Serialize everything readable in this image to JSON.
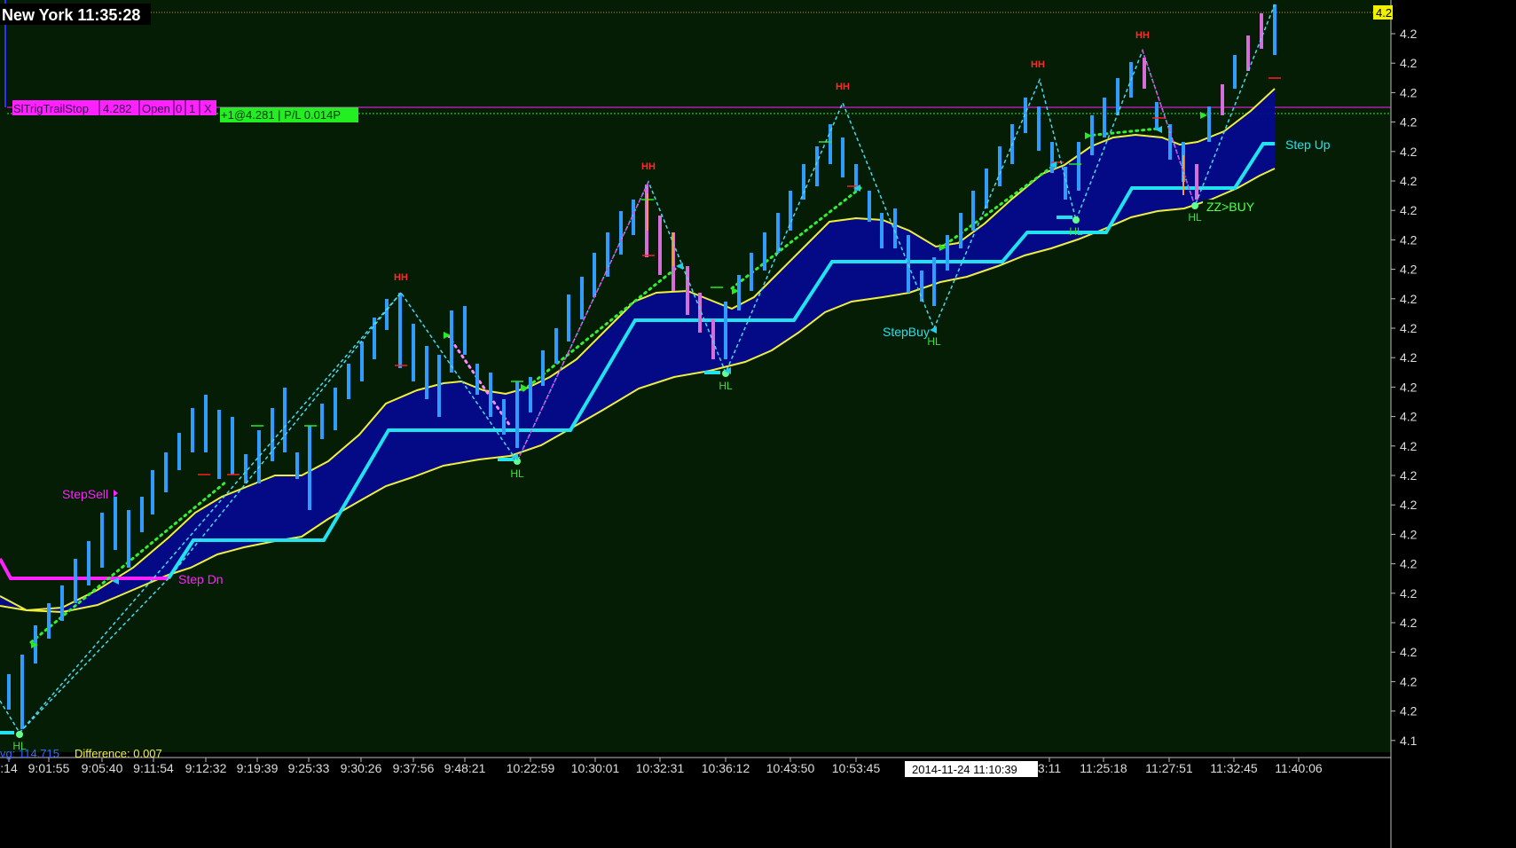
{
  "clock_label": "New York 11:35:28",
  "order_bar": {
    "strategy": "SlTrigTrailStop",
    "price": "4.282",
    "status": "Open",
    "qty_a": "0",
    "qty_b": "1",
    "close": "X"
  },
  "position_label": "+1@4.281 | P/L 0.014P",
  "bottom_status": {
    "avg": "vg: 114.715",
    "difference": "Difference: 0.007"
  },
  "crosshair_time": "2014-11-24  11:10:39",
  "price_axis": {
    "current_price_box": "4.2",
    "tick_labels": [
      "4.2",
      "4.2",
      "4.2",
      "4.2",
      "4.2",
      "4.2",
      "4.2",
      "4.2",
      "4.2",
      "4.2",
      "4.2",
      "4.2",
      "4.2",
      "4.2",
      "4.2",
      "4.2",
      "4.2",
      "4.2",
      "4.2",
      "4.2",
      "4.2",
      "4.2",
      "4.2",
      "4.2",
      "4.1"
    ]
  },
  "time_axis": {
    "tick_labels": [
      ":14",
      "9:01:55",
      "9:05:40",
      "9:11:54",
      "9:12:32",
      "9:19:39",
      "9:25:33",
      "9:30:26",
      "9:37:56",
      "9:48:21",
      "10:22:59",
      "10:30:01",
      "10:32:31",
      "10:36:12",
      "10:43:50",
      "10:53:45",
      "3:11",
      "11:25:18",
      "11:27:51",
      "11:32:45",
      "11:40:06"
    ]
  },
  "annotations": {
    "hh": "HH",
    "hl": "HL",
    "step_sell": "StepSell",
    "step_dn": "Step Dn",
    "step_buy": "StepBuy",
    "step_up": "Step Up",
    "zz_buy": "ZZ>BUY"
  },
  "colors": {
    "background": "#061d05",
    "bars_up": "#2f9cff",
    "bars_down": "#d76dd8",
    "zigzag": "#49d8f0",
    "band_fill": "#040a8c",
    "band_line": "#f0f03a",
    "step_line": "#21e3ef",
    "step_line_sell": "#ff22ff",
    "trend_dots": "#34ee34",
    "hh": "#ff2a2a",
    "hl": "#39e139",
    "order_bar_bg": "#ff22ff",
    "position_bg": "#22ee22"
  },
  "chart_data": {
    "type": "line",
    "title": "",
    "symbol_clock": "New York 11:35:28",
    "x": [
      "9:01:55",
      "9:05:40",
      "9:11:54",
      "9:12:32",
      "9:19:39",
      "9:25:33",
      "9:30:26",
      "9:37:56",
      "9:48:21",
      "10:22:59",
      "10:30:01",
      "10:32:31",
      "10:36:12",
      "10:43:50",
      "10:53:45",
      "11:10:39",
      "11:25:18",
      "11:27:51",
      "11:32:45",
      "11:40:06"
    ],
    "series": [
      {
        "name": "Step Dn",
        "values": [
          4.173,
          4.173,
          4.173,
          null,
          null,
          null,
          null,
          null,
          null,
          null,
          null,
          null,
          null,
          null,
          null,
          null,
          null,
          null,
          null,
          null
        ]
      },
      {
        "name": "Step Up",
        "values": [
          null,
          null,
          null,
          4.203,
          4.203,
          4.203,
          4.232,
          4.232,
          4.232,
          4.232,
          4.271,
          4.271,
          4.271,
          4.272,
          4.272,
          4.276,
          4.276,
          4.282,
          4.282,
          4.282
        ]
      }
    ],
    "zigzag_points": [
      {
        "label": "HL",
        "x": "9:01:55"
      },
      {
        "label": "HH",
        "x": "9:37:56"
      },
      {
        "label": "HL",
        "x": "10:22:59"
      },
      {
        "label": "HH",
        "x": "10:30:01"
      },
      {
        "label": "HL",
        "x": "10:36:12"
      },
      {
        "label": "HH",
        "x": "10:43:50"
      },
      {
        "label": "HL",
        "x": "10:53:45"
      },
      {
        "label": "HH",
        "x": "11:10:39"
      },
      {
        "label": "HL",
        "x": "11:25:18"
      },
      {
        "label": "HH",
        "x": "11:27:51"
      },
      {
        "label": "HL",
        "x": "11:32:45"
      }
    ],
    "annotation_labels": [
      "StepSell",
      "Step Dn",
      "StepBuy",
      "Step Up",
      "ZZ>BUY"
    ],
    "grid": false,
    "legend": "none"
  }
}
